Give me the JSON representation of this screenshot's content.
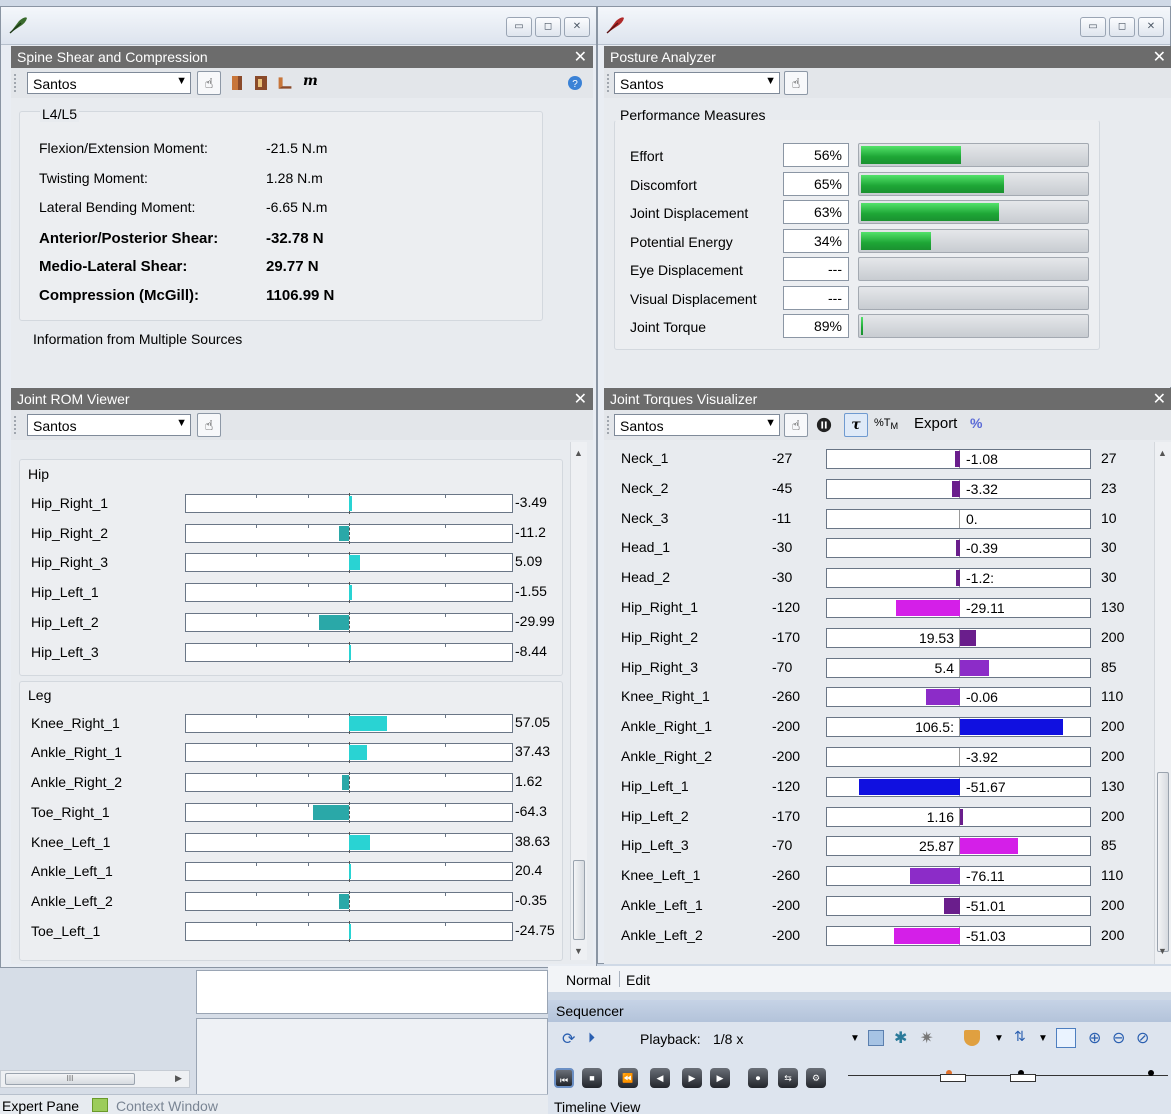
{
  "left_window": {
    "spine": {
      "title": "Spine Shear and Compression",
      "figure": "Santos",
      "mass_label": "m",
      "section": "L4/L5",
      "rows": [
        {
          "label": "Flexion/Extension Moment:",
          "value": "-21.5 N.m",
          "bold": false
        },
        {
          "label": "Twisting Moment:",
          "value": "1.28 N.m",
          "bold": false
        },
        {
          "label": "Lateral Bending Moment:",
          "value": "-6.65 N.m",
          "bold": false
        },
        {
          "label": "Anterior/Posterior Shear:",
          "value": "-32.78 N",
          "bold": true
        },
        {
          "label": "Medio-Lateral Shear:",
          "value": "29.77 N",
          "bold": true
        },
        {
          "label": "Compression (McGill):",
          "value": "1106.99 N",
          "bold": true
        }
      ],
      "footer": "Information from Multiple Sources"
    },
    "rom": {
      "title": "Joint ROM Viewer",
      "figure": "Santos",
      "hip_group": "Hip",
      "leg_group": "Leg",
      "hip": [
        {
          "name": "Hip_Right_1",
          "value": "-3.49",
          "fill": "+0.01"
        },
        {
          "name": "Hip_Right_2",
          "value": "-11.2",
          "fill": "-0.03"
        },
        {
          "name": "Hip_Right_3",
          "value": "5.09",
          "fill": "+0.035"
        },
        {
          "name": "Hip_Left_1",
          "value": "-1.55",
          "fill": "+0.01"
        },
        {
          "name": "Hip_Left_2",
          "value": "-29.99",
          "fill": "-0.09"
        },
        {
          "name": "Hip_Left_3",
          "value": "-8.44",
          "fill": "0"
        }
      ],
      "leg": [
        {
          "name": "Knee_Right_1",
          "value": "57.05",
          "fill": "+0.115"
        },
        {
          "name": "Ankle_Right_1",
          "value": "37.43",
          "fill": "+0.055"
        },
        {
          "name": "Ankle_Right_2",
          "value": "1.62",
          "fill": "-0.02"
        },
        {
          "name": "Toe_Right_1",
          "value": "-64.3",
          "fill": "-0.11"
        },
        {
          "name": "Knee_Left_1",
          "value": "38.63",
          "fill": "+0.065"
        },
        {
          "name": "Ankle_Left_1",
          "value": "20.4",
          "fill": "+0.006"
        },
        {
          "name": "Ankle_Left_2",
          "value": "-0.35",
          "fill": "-0.03"
        },
        {
          "name": "Toe_Left_1",
          "value": "-24.75",
          "fill": "0"
        }
      ]
    }
  },
  "right_window": {
    "posture": {
      "title": "Posture Analyzer",
      "figure": "Santos",
      "group": "Performance Measures",
      "measures": [
        {
          "name": "Effort",
          "pct": "56%",
          "level": 0.44
        },
        {
          "name": "Discomfort",
          "pct": "65%",
          "level": 0.63
        },
        {
          "name": "Joint Displacement",
          "pct": "63%",
          "level": 0.61
        },
        {
          "name": "Potential Energy",
          "pct": "34%",
          "level": 0.31
        },
        {
          "name": "Eye Displacement",
          "pct": "---",
          "level": 0
        },
        {
          "name": "Visual Displacement",
          "pct": "---",
          "level": 0
        },
        {
          "name": "Joint Torque",
          "pct": "89%",
          "level": 0.01
        }
      ]
    },
    "torques": {
      "title": "Joint Torques Visualizer",
      "figure": "Santos",
      "export_label": "Export",
      "pct_label": "%",
      "rows": [
        {
          "name": "Neck_1",
          "min": "-27",
          "value": "-1.08",
          "max": "27",
          "color": "#6a1e8c",
          "side": "neg",
          "size": 0.02
        },
        {
          "name": "Neck_2",
          "min": "-45",
          "value": "-3.32",
          "max": "23",
          "color": "#6a1e8c",
          "side": "neg",
          "size": 0.03
        },
        {
          "name": "Neck_3",
          "min": "-11",
          "value": "0.",
          "max": "10",
          "color": "#6a1e8c",
          "side": "none",
          "size": 0
        },
        {
          "name": "Head_1",
          "min": "-30",
          "value": "-0.39",
          "max": "30",
          "color": "#6a1e8c",
          "side": "neg",
          "size": 0.015
        },
        {
          "name": "Head_2",
          "min": "-30",
          "value": "-1.2:",
          "max": "30",
          "color": "#6a1e8c",
          "side": "neg",
          "size": 0.015
        },
        {
          "name": "Hip_Right_1",
          "min": "-120",
          "value": "-29.11",
          "max": "130",
          "color": "#d41fe8",
          "side": "neg",
          "size": 0.24
        },
        {
          "name": "Hip_Right_2",
          "min": "-170",
          "value": "19.53",
          "max": "200",
          "color": "#6a1e8c",
          "side": "pos",
          "size": 0.06
        },
        {
          "name": "Hip_Right_3",
          "min": "-70",
          "value": "5.4",
          "max": "85",
          "color": "#8c2cc8",
          "side": "pos",
          "size": 0.11
        },
        {
          "name": "Knee_Right_1",
          "min": "-260",
          "value": "-0.06",
          "max": "110",
          "color": "#8c2cc8",
          "side": "neg",
          "size": 0.13
        },
        {
          "name": "Ankle_Right_1",
          "min": "-200",
          "value": "106.5:",
          "max": "200",
          "color": "#1010e0",
          "side": "pos",
          "size": 0.39
        },
        {
          "name": "Ankle_Right_2",
          "min": "-200",
          "value": "-3.92",
          "max": "200",
          "color": "#6a1e8c",
          "side": "none",
          "size": 0
        },
        {
          "name": "Hip_Left_1",
          "min": "-120",
          "value": "-51.67",
          "max": "130",
          "color": "#1010e0",
          "side": "neg",
          "size": 0.38
        },
        {
          "name": "Hip_Left_2",
          "min": "-170",
          "value": "1.16",
          "max": "200",
          "color": "#6a1e8c",
          "side": "pos",
          "size": 0.01
        },
        {
          "name": "Hip_Left_3",
          "min": "-70",
          "value": "25.87",
          "max": "85",
          "color": "#d41fe8",
          "side": "pos",
          "size": 0.22
        },
        {
          "name": "Knee_Left_1",
          "min": "-260",
          "value": "-76.11",
          "max": "110",
          "color": "#8c2cc8",
          "side": "neg",
          "size": 0.19
        },
        {
          "name": "Ankle_Left_1",
          "min": "-200",
          "value": "-51.01",
          "max": "200",
          "color": "#6a1e8c",
          "side": "neg",
          "size": 0.06
        },
        {
          "name": "Ankle_Left_2",
          "min": "-200",
          "value": "-51.03",
          "max": "200",
          "color": "#d41fe8",
          "side": "neg",
          "size": 0.25
        }
      ]
    }
  },
  "bottom": {
    "mode_tabs": [
      "Normal",
      "Edit"
    ],
    "sequencer_title": "Sequencer",
    "playback_label": "Playback:",
    "playback_value": "1/8 x",
    "timeline_label": "Timeline View",
    "pane_tabs": [
      "Expert Pane",
      "Context Window"
    ],
    "hscroll_mark": "III"
  }
}
